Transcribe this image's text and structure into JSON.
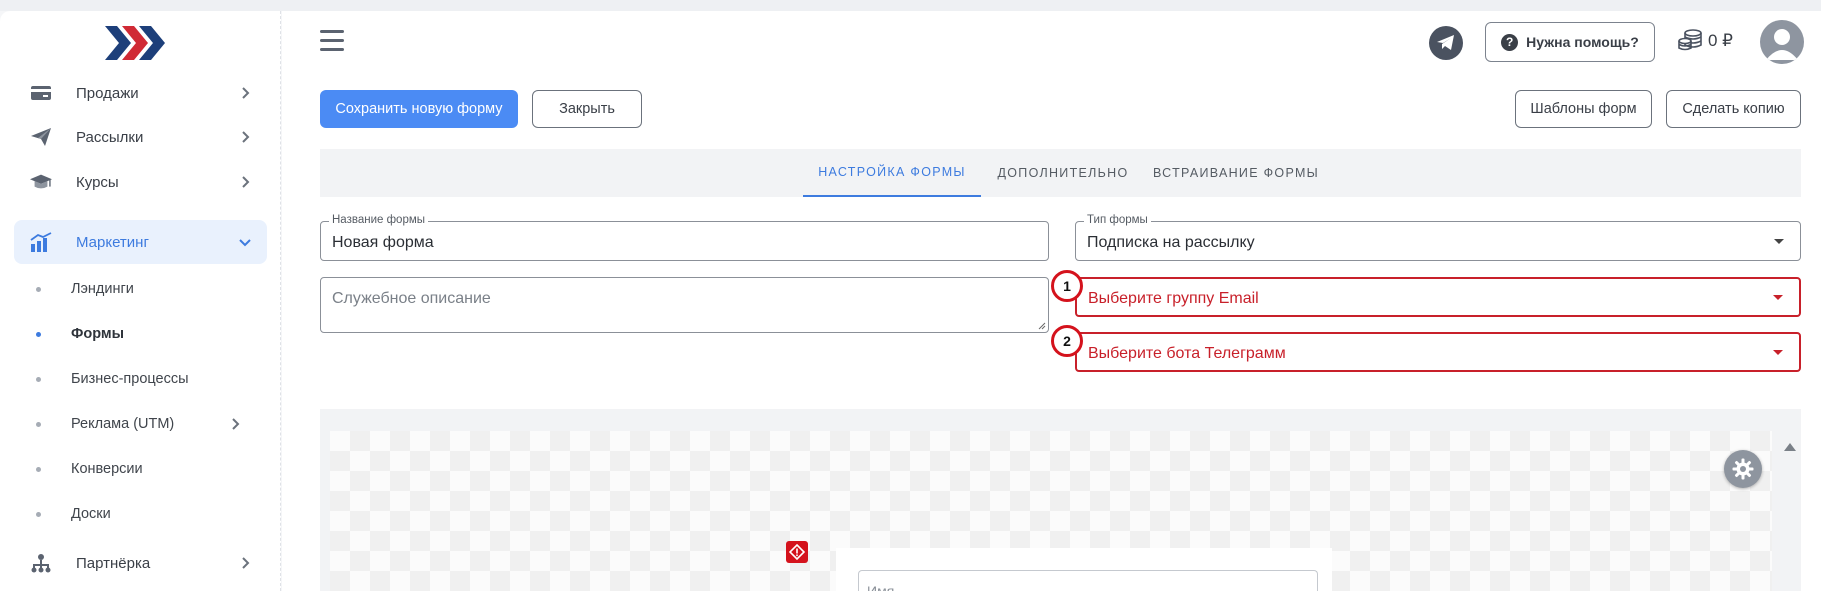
{
  "colors": {
    "accent": "#4b8bf4",
    "active_nav": "#3d7bdf",
    "error": "#c8202a",
    "badge_border": "#d4121c"
  },
  "sidebar": {
    "items": [
      {
        "label": "Продажи",
        "icon": "credit-card-icon"
      },
      {
        "label": "Рассылки",
        "icon": "paper-plane-icon"
      },
      {
        "label": "Курсы",
        "icon": "graduation-cap-icon"
      },
      {
        "label": "Маркетинг",
        "icon": "chart-bar-icon",
        "active": true
      },
      {
        "label": "Партнёрка",
        "icon": "sitemap-icon"
      }
    ],
    "subitems": [
      {
        "label": "Лэндинги"
      },
      {
        "label": "Формы",
        "active": true
      },
      {
        "label": "Бизнес-процессы"
      },
      {
        "label": "Реклама (UTM)",
        "has_chevron": true
      },
      {
        "label": "Конверсии"
      },
      {
        "label": "Доски"
      }
    ]
  },
  "header": {
    "help_label": "Нужна помощь?",
    "balance": "0 ₽"
  },
  "toolbar": {
    "save_label": "Сохранить новую форму",
    "close_label": "Закрыть",
    "templates_label": "Шаблоны форм",
    "copy_label": "Сделать копию"
  },
  "tabs": [
    {
      "label": "НАСТРОЙКА ФОРМЫ",
      "active": true
    },
    {
      "label": "ДОПОЛНИТЕЛЬНО"
    },
    {
      "label": "ВСТРАИВАНИЕ ФОРМЫ"
    }
  ],
  "form": {
    "name_legend": "Название формы",
    "name_value": "Новая форма",
    "type_legend": "Тип формы",
    "type_value": "Подписка на рассылку",
    "description_placeholder": "Служебное описание",
    "email_group_placeholder": "Выберите группу Email",
    "telegram_bot_placeholder": "Выберите бота Телеграмм",
    "badge_1": "1",
    "badge_2": "2"
  },
  "preview": {
    "name_placeholder": "Имя"
  }
}
